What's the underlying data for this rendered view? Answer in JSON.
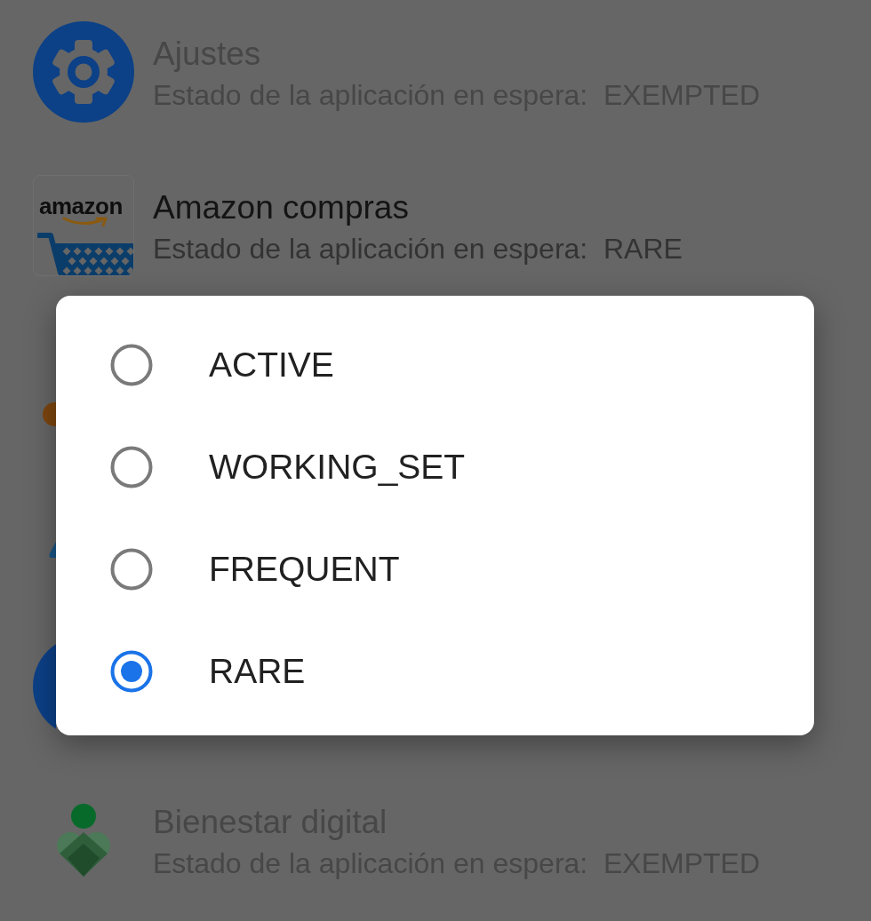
{
  "apps": [
    {
      "title": "Ajustes",
      "status": "Estado de la aplicación en espera:  EXEMPTED",
      "disabled": true,
      "covered": false
    },
    {
      "title": "Amazon compras",
      "status": "Estado de la aplicación en espera:  RARE",
      "logo_text": "amazon",
      "disabled": false,
      "covered": false
    },
    {
      "disabled": true,
      "covered": true
    },
    {
      "disabled": true,
      "covered": true
    },
    {
      "disabled": true,
      "covered": true
    },
    {
      "title": "Bienestar digital",
      "status": "Estado de la aplicación en espera:  EXEMPTED",
      "disabled": true,
      "covered": false
    }
  ],
  "dialog": {
    "options": [
      {
        "label": "ACTIVE",
        "selected": false
      },
      {
        "label": "WORKING_SET",
        "selected": false
      },
      {
        "label": "FREQUENT",
        "selected": false
      },
      {
        "label": "RARE",
        "selected": true
      }
    ]
  }
}
